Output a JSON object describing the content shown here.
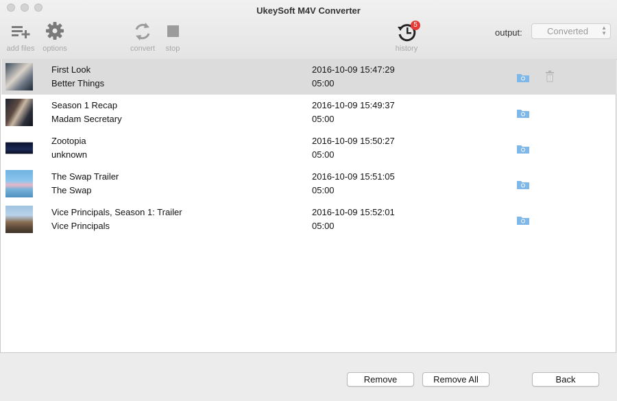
{
  "window": {
    "title": "UkeySoft M4V Converter"
  },
  "toolbar": {
    "add_files_label": "add files",
    "options_label": "options",
    "convert_label": "convert",
    "stop_label": "stop",
    "history_label": "history",
    "history_badge": "5",
    "output_label": "output:",
    "output_value": "Converted"
  },
  "icons": {
    "add_files": "playlist-add-icon",
    "options": "gear-icon",
    "convert": "refresh-icon",
    "stop": "stop-icon",
    "history": "history-icon",
    "folder": "folder-icon",
    "trash": "trash-icon"
  },
  "colors": {
    "selected_row": "#dcdcdc",
    "badge": "#e53935",
    "folder": "#7fb8e8",
    "toolbar_icon": "#7a7a7a"
  },
  "list": {
    "items": [
      {
        "title": "First Look",
        "subtitle": "Better Things",
        "date": "2016-10-09 15:47:29",
        "duration": "05:00",
        "selected": true
      },
      {
        "title": "Season 1 Recap",
        "subtitle": "Madam Secretary",
        "date": "2016-10-09 15:49:37",
        "duration": "05:00",
        "selected": false
      },
      {
        "title": "Zootopia",
        "subtitle": "unknown",
        "date": "2016-10-09 15:50:27",
        "duration": "05:00",
        "selected": false
      },
      {
        "title": "The Swap Trailer",
        "subtitle": "The Swap",
        "date": "2016-10-09 15:51:05",
        "duration": "05:00",
        "selected": false
      },
      {
        "title": "Vice Principals, Season 1: Trailer",
        "subtitle": "Vice Principals",
        "date": "2016-10-09 15:52:01",
        "duration": "05:00",
        "selected": false
      }
    ]
  },
  "buttons": {
    "remove": "Remove",
    "remove_all": "Remove All",
    "back": "Back"
  }
}
